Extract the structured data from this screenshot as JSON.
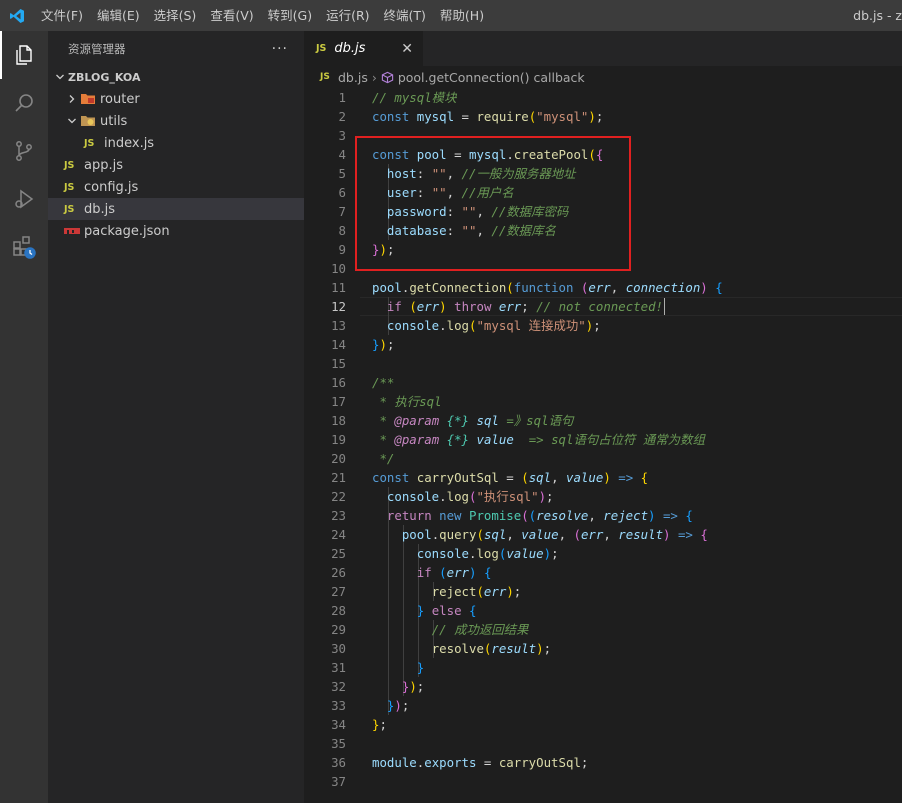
{
  "titlebar": {
    "menu": [
      "文件(F)",
      "编辑(E)",
      "选择(S)",
      "查看(V)",
      "转到(G)",
      "运行(R)",
      "终端(T)",
      "帮助(H)"
    ],
    "window_title": "db.js - z"
  },
  "activitybar": {
    "icons": [
      "files-icon",
      "search-icon",
      "source-control-icon",
      "run-debug-icon",
      "extensions-icon"
    ]
  },
  "sidebar": {
    "title": "资源管理器",
    "more": "···",
    "root": "ZBLOG_KOA",
    "items": [
      {
        "label": "router",
        "kind": "folder",
        "expanded": false
      },
      {
        "label": "utils",
        "kind": "folder",
        "expanded": true
      },
      {
        "label": "index.js",
        "kind": "js",
        "badge": "JS"
      },
      {
        "label": "app.js",
        "kind": "js",
        "badge": "JS"
      },
      {
        "label": "config.js",
        "kind": "js",
        "badge": "JS"
      },
      {
        "label": "db.js",
        "kind": "js",
        "badge": "JS",
        "selected": true
      },
      {
        "label": "package.json",
        "kind": "json"
      }
    ]
  },
  "editor": {
    "tab": {
      "badge": "JS",
      "label": "db.js",
      "close": "✕"
    },
    "breadcrumb": {
      "badge": "JS",
      "file": "db.js",
      "sep": "›",
      "symbol": "pool.getConnection() callback"
    },
    "current_line": 12,
    "lines": [
      [
        [
          "cm",
          "// mysql模块"
        ]
      ],
      [
        [
          "kw",
          "const "
        ],
        [
          "var",
          "mysql"
        ],
        [
          "pun",
          " = "
        ],
        [
          "fn",
          "require"
        ],
        [
          "br1",
          "("
        ],
        [
          "str",
          "\"mysql\""
        ],
        [
          "br1",
          ")"
        ],
        [
          "pun",
          ";"
        ]
      ],
      [],
      [
        [
          "kw",
          "const "
        ],
        [
          "var",
          "pool"
        ],
        [
          "pun",
          " = "
        ],
        [
          "var",
          "mysql"
        ],
        [
          "pun",
          "."
        ],
        [
          "fn",
          "createPool"
        ],
        [
          "br1",
          "("
        ],
        [
          "br2",
          "{"
        ]
      ],
      [
        [
          "pun",
          "  "
        ],
        [
          "var",
          "host"
        ],
        [
          "pun",
          ": "
        ],
        [
          "str",
          "\"\""
        ],
        [
          "pun",
          ", "
        ],
        [
          "cm",
          "//一般为服务器地址"
        ]
      ],
      [
        [
          "pun",
          "  "
        ],
        [
          "var",
          "user"
        ],
        [
          "pun",
          ": "
        ],
        [
          "str",
          "\"\""
        ],
        [
          "pun",
          ", "
        ],
        [
          "cm",
          "//用户名"
        ]
      ],
      [
        [
          "pun",
          "  "
        ],
        [
          "var",
          "password"
        ],
        [
          "pun",
          ": "
        ],
        [
          "str",
          "\"\""
        ],
        [
          "pun",
          ", "
        ],
        [
          "cm",
          "//数据库密码"
        ]
      ],
      [
        [
          "pun",
          "  "
        ],
        [
          "var",
          "database"
        ],
        [
          "pun",
          ": "
        ],
        [
          "str",
          "\"\""
        ],
        [
          "pun",
          ", "
        ],
        [
          "cm",
          "//数据库名"
        ]
      ],
      [
        [
          "br2",
          "}"
        ],
        [
          "br1",
          ")"
        ],
        [
          "pun",
          ";"
        ]
      ],
      [],
      [
        [
          "var",
          "pool"
        ],
        [
          "pun",
          "."
        ],
        [
          "fn",
          "getConnection"
        ],
        [
          "br1",
          "("
        ],
        [
          "kw",
          "function "
        ],
        [
          "br2",
          "("
        ],
        [
          "par",
          "err"
        ],
        [
          "pun",
          ", "
        ],
        [
          "par",
          "connection"
        ],
        [
          "br2",
          ")"
        ],
        [
          "pun",
          " "
        ],
        [
          "br3",
          "{"
        ]
      ],
      [
        [
          "pun",
          "  "
        ],
        [
          "ctl",
          "if "
        ],
        [
          "br1",
          "("
        ],
        [
          "par",
          "err"
        ],
        [
          "br1",
          ")"
        ],
        [
          "pun",
          " "
        ],
        [
          "ctl",
          "throw "
        ],
        [
          "par",
          "err"
        ],
        [
          "pun",
          "; "
        ],
        [
          "cm",
          "// not connected!"
        ]
      ],
      [
        [
          "pun",
          "  "
        ],
        [
          "var",
          "console"
        ],
        [
          "pun",
          "."
        ],
        [
          "fn",
          "log"
        ],
        [
          "br1",
          "("
        ],
        [
          "str",
          "\"mysql 连接成功\""
        ],
        [
          "br1",
          ")"
        ],
        [
          "pun",
          ";"
        ]
      ],
      [
        [
          "br3",
          "}"
        ],
        [
          "br1",
          ")"
        ],
        [
          "pun",
          ";"
        ]
      ],
      [],
      [
        [
          "cm",
          "/**"
        ]
      ],
      [
        [
          "cm",
          " * 执行sql"
        ]
      ],
      [
        [
          "cm",
          " * "
        ],
        [
          "tag",
          "@param"
        ],
        [
          "cm",
          " "
        ],
        [
          "typ",
          "{*}"
        ],
        [
          "cm",
          " "
        ],
        [
          "par",
          "sql"
        ],
        [
          "cm",
          " =》sql语句"
        ]
      ],
      [
        [
          "cm",
          " * "
        ],
        [
          "tag",
          "@param"
        ],
        [
          "cm",
          " "
        ],
        [
          "typ",
          "{*}"
        ],
        [
          "cm",
          " "
        ],
        [
          "par",
          "value"
        ],
        [
          "cm",
          "  => sql语句占位符 通常为数组"
        ]
      ],
      [
        [
          "cm",
          " */"
        ]
      ],
      [
        [
          "kw",
          "const "
        ],
        [
          "fn",
          "carryOutSql"
        ],
        [
          "pun",
          " = "
        ],
        [
          "br1",
          "("
        ],
        [
          "par",
          "sql"
        ],
        [
          "pun",
          ", "
        ],
        [
          "par",
          "value"
        ],
        [
          "br1",
          ")"
        ],
        [
          "kw",
          " => "
        ],
        [
          "br1",
          "{"
        ]
      ],
      [
        [
          "pun",
          "  "
        ],
        [
          "var",
          "console"
        ],
        [
          "pun",
          "."
        ],
        [
          "fn",
          "log"
        ],
        [
          "br2",
          "("
        ],
        [
          "str",
          "\"执行sql\""
        ],
        [
          "br2",
          ")"
        ],
        [
          "pun",
          ";"
        ]
      ],
      [
        [
          "pun",
          "  "
        ],
        [
          "ctl",
          "return "
        ],
        [
          "kw",
          "new "
        ],
        [
          "cls",
          "Promise"
        ],
        [
          "br2",
          "("
        ],
        [
          "br3",
          "("
        ],
        [
          "par",
          "resolve"
        ],
        [
          "pun",
          ", "
        ],
        [
          "par",
          "reject"
        ],
        [
          "br3",
          ")"
        ],
        [
          "kw",
          " => "
        ],
        [
          "br3",
          "{"
        ]
      ],
      [
        [
          "pun",
          "    "
        ],
        [
          "var",
          "pool"
        ],
        [
          "pun",
          "."
        ],
        [
          "fn",
          "query"
        ],
        [
          "br1",
          "("
        ],
        [
          "par",
          "sql"
        ],
        [
          "pun",
          ", "
        ],
        [
          "par",
          "value"
        ],
        [
          "pun",
          ", "
        ],
        [
          "br2",
          "("
        ],
        [
          "par",
          "err"
        ],
        [
          "pun",
          ", "
        ],
        [
          "par",
          "result"
        ],
        [
          "br2",
          ")"
        ],
        [
          "kw",
          " => "
        ],
        [
          "br2",
          "{"
        ]
      ],
      [
        [
          "pun",
          "      "
        ],
        [
          "var",
          "console"
        ],
        [
          "pun",
          "."
        ],
        [
          "fn",
          "log"
        ],
        [
          "br3",
          "("
        ],
        [
          "par",
          "value"
        ],
        [
          "br3",
          ")"
        ],
        [
          "pun",
          ";"
        ]
      ],
      [
        [
          "pun",
          "      "
        ],
        [
          "ctl",
          "if "
        ],
        [
          "br3",
          "("
        ],
        [
          "par",
          "err"
        ],
        [
          "br3",
          ")"
        ],
        [
          "pun",
          " "
        ],
        [
          "br3",
          "{"
        ]
      ],
      [
        [
          "pun",
          "        "
        ],
        [
          "fn",
          "reject"
        ],
        [
          "br1",
          "("
        ],
        [
          "par",
          "err"
        ],
        [
          "br1",
          ")"
        ],
        [
          "pun",
          ";"
        ]
      ],
      [
        [
          "pun",
          "      "
        ],
        [
          "br3",
          "}"
        ],
        [
          "ctl",
          " else "
        ],
        [
          "br3",
          "{"
        ]
      ],
      [
        [
          "pun",
          "        "
        ],
        [
          "cm",
          "// 成功返回结果"
        ]
      ],
      [
        [
          "pun",
          "        "
        ],
        [
          "fn",
          "resolve"
        ],
        [
          "br1",
          "("
        ],
        [
          "par",
          "result"
        ],
        [
          "br1",
          ")"
        ],
        [
          "pun",
          ";"
        ]
      ],
      [
        [
          "pun",
          "      "
        ],
        [
          "br3",
          "}"
        ]
      ],
      [
        [
          "pun",
          "    "
        ],
        [
          "br2",
          "}"
        ],
        [
          "br1",
          ")"
        ],
        [
          "pun",
          ";"
        ]
      ],
      [
        [
          "pun",
          "  "
        ],
        [
          "br3",
          "}"
        ],
        [
          "br2",
          ")"
        ],
        [
          "pun",
          ";"
        ]
      ],
      [
        [
          "br1",
          "}"
        ],
        [
          "pun",
          ";"
        ]
      ],
      [],
      [
        [
          "var",
          "module"
        ],
        [
          "pun",
          "."
        ],
        [
          "var",
          "exports"
        ],
        [
          "pun",
          " = "
        ],
        [
          "fn",
          "carryOutSql"
        ],
        [
          "pun",
          ";"
        ]
      ],
      []
    ]
  }
}
